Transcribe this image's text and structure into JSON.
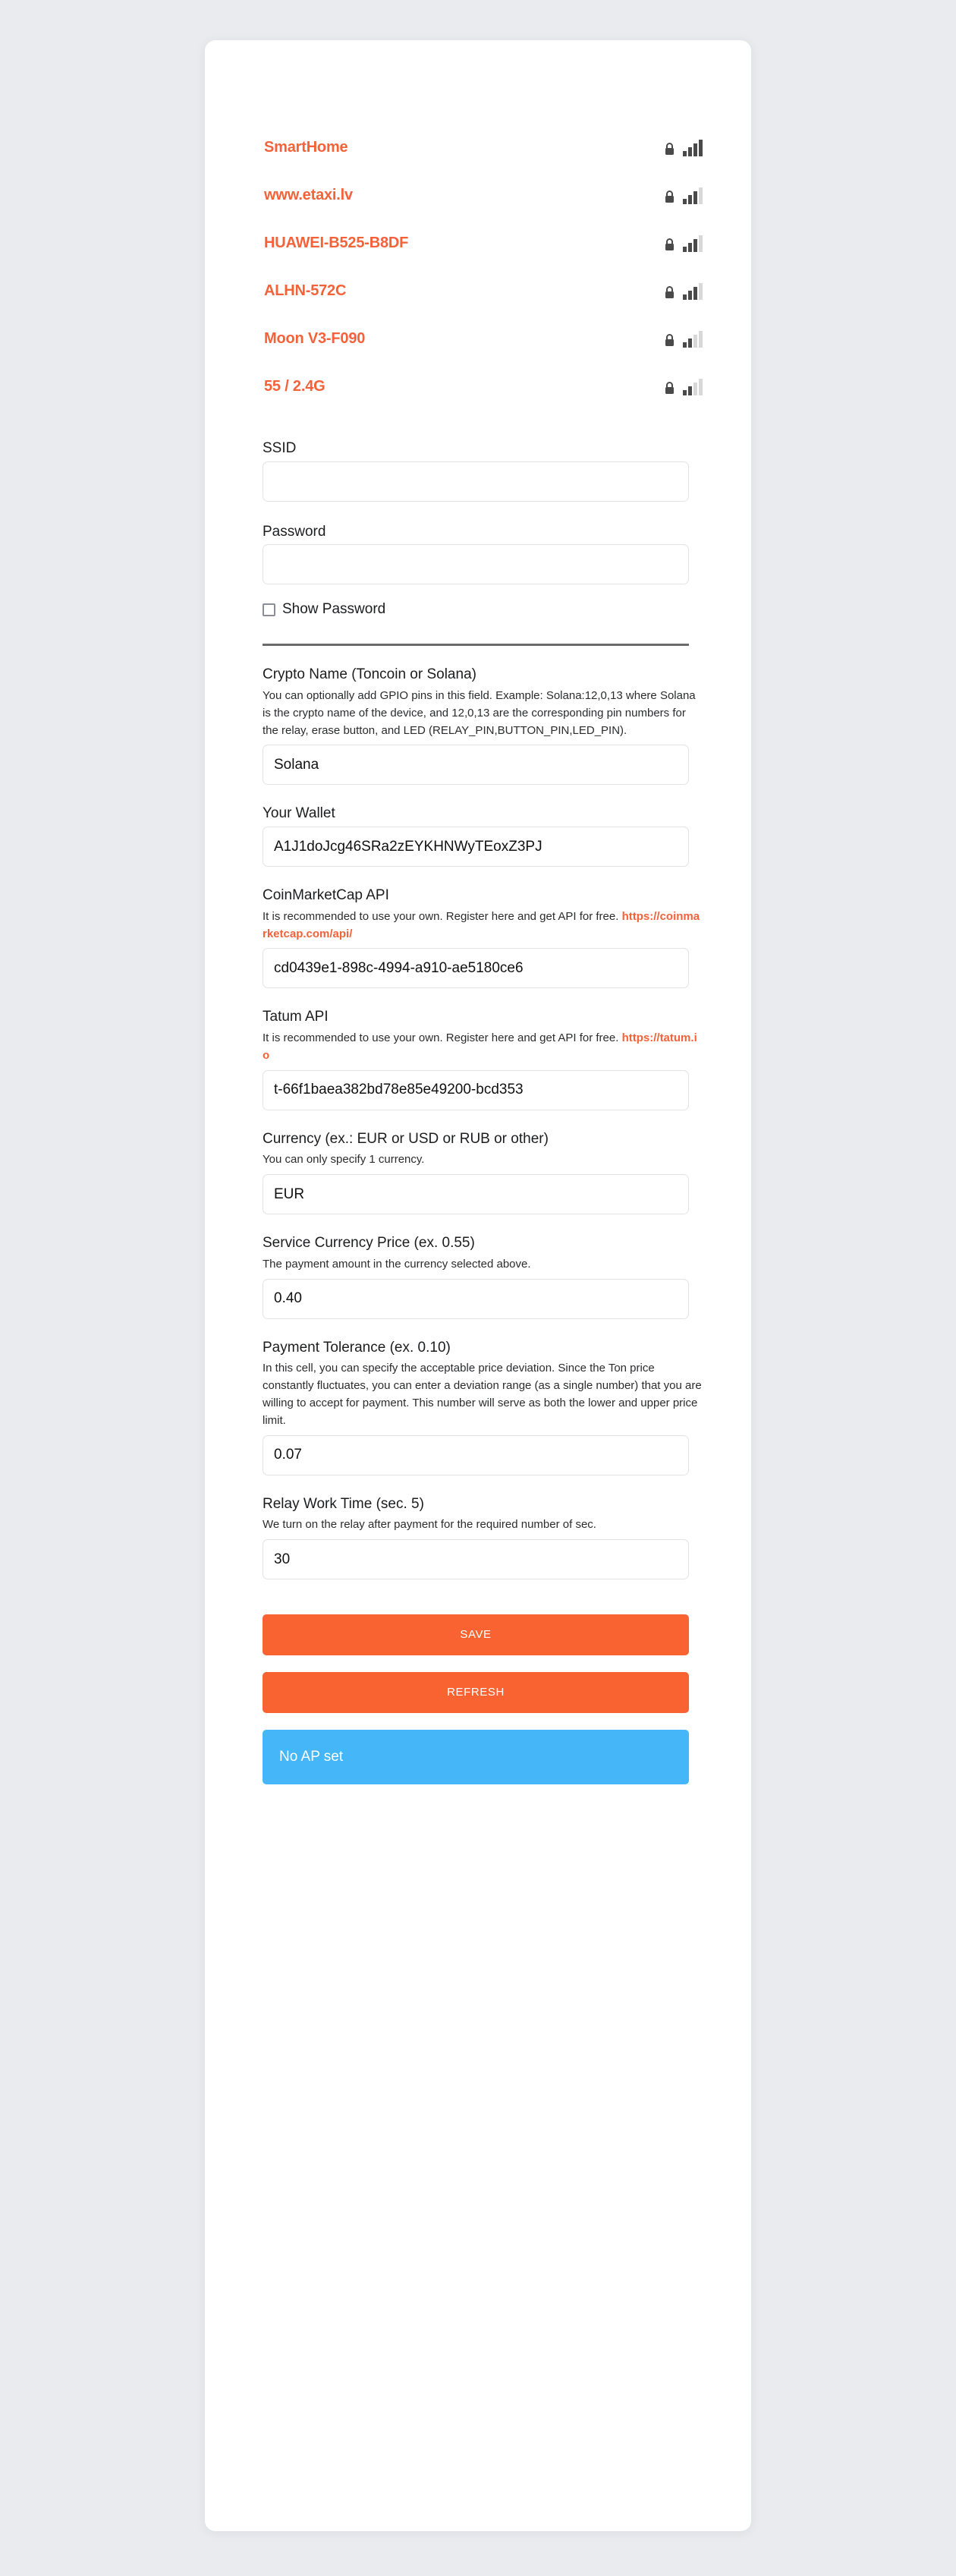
{
  "theme": {
    "accent_orange": "#f96332",
    "network_name_color": "#f4623a",
    "status_blue": "#45b6f7",
    "page_background": "#e9ebef",
    "card_background": "#ffffff"
  },
  "networks": {
    "items": [
      {
        "ssid": "SmartHome",
        "secured": true,
        "signal_bars": 4,
        "lock_icon": "lock-icon",
        "signal_icon": "signal-bars-icon"
      },
      {
        "ssid": "www.etaxi.lv",
        "secured": true,
        "signal_bars": 3,
        "lock_icon": "lock-icon",
        "signal_icon": "signal-bars-icon"
      },
      {
        "ssid": "HUAWEI-B525-B8DF",
        "secured": true,
        "signal_bars": 3,
        "lock_icon": "lock-icon",
        "signal_icon": "signal-bars-icon"
      },
      {
        "ssid": "ALHN-572C",
        "secured": true,
        "signal_bars": 3,
        "lock_icon": "lock-icon",
        "signal_icon": "signal-bars-icon"
      },
      {
        "ssid": "Moon V3-F090",
        "secured": true,
        "signal_bars": 2,
        "lock_icon": "lock-icon",
        "signal_icon": "signal-bars-icon"
      },
      {
        "ssid": "55 / 2.4G",
        "secured": true,
        "signal_bars": 2,
        "lock_icon": "lock-icon",
        "signal_icon": "signal-bars-icon"
      }
    ]
  },
  "wifi_form": {
    "ssid": {
      "label": "SSID",
      "value": "",
      "placeholder": ""
    },
    "password": {
      "label": "Password",
      "value": "",
      "placeholder": ""
    },
    "show_password": {
      "label": "Show Password",
      "checked": false
    }
  },
  "settings": {
    "crypto_name": {
      "label": "Crypto Name (Toncoin or Solana)",
      "help": "You can optionally add GPIO pins in this field. Example: Solana:12,0,13 where Solana is the crypto name of the device, and 12,0,13 are the corresponding pin numbers for the relay, erase button, and LED (RELAY_PIN,BUTTON_PIN,LED_PIN).",
      "value": "Solana",
      "placeholder": ""
    },
    "wallet": {
      "label": "Your Wallet",
      "value": "A1J1doJcg46SRa2zEYKHNWyTEoxZ3PJ",
      "placeholder": ""
    },
    "coinmarketcap_api": {
      "label": "CoinMarketCap API",
      "help_prefix": "It is recommended to use your own. Register here and get API for free. ",
      "help_link": "https://coinmarketcap.com/api/",
      "value": "cd0439e1-898c-4994-a910-ae5180ce6",
      "placeholder": ""
    },
    "tatum_api": {
      "label": "Tatum API",
      "help_prefix": "It is recommended to use your own. Register here and get API for free. ",
      "help_link": "https://tatum.io",
      "value": "t-66f1baea382bd78e85e49200-bcd353",
      "placeholder": ""
    },
    "currency": {
      "label": "Currency (ex.: EUR or USD or RUB or other)",
      "help": "You can only specify 1 currency.",
      "value": "EUR",
      "placeholder": ""
    },
    "service_price": {
      "label": "Service Currency Price (ex. 0.55)",
      "help": "The payment amount in the currency selected above.",
      "value": "0.40",
      "placeholder": ""
    },
    "payment_tolerance": {
      "label": "Payment Tolerance (ex. 0.10)",
      "help": "In this cell, you can specify the acceptable price deviation. Since the Ton price constantly fluctuates, you can enter a deviation range (as a single number) that you are willing to accept for payment. This number will serve as both the lower and upper price limit.",
      "value": "0.07",
      "placeholder": ""
    },
    "relay_work_time": {
      "label": "Relay Work Time (sec. 5)",
      "help": "We turn on the relay after payment for the required number of sec.",
      "value": "30",
      "placeholder": ""
    }
  },
  "actions": {
    "save_label": "SAVE",
    "refresh_label": "REFRESH",
    "status_label": "No AP set"
  }
}
